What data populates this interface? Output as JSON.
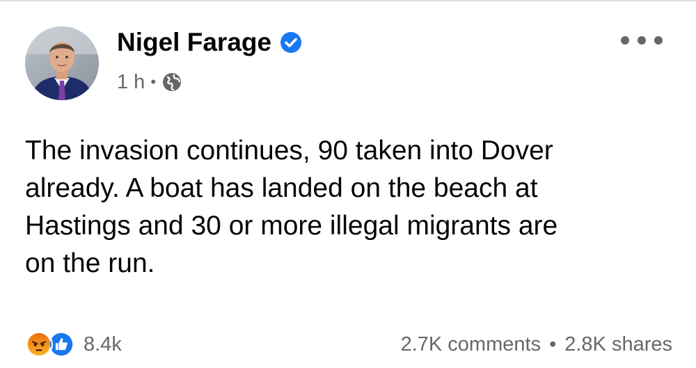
{
  "post": {
    "author": "Nigel Farage",
    "verified": true,
    "timestamp": "1 h",
    "separator": "•",
    "visibility_icon": "globe-icon",
    "text": "The invasion continues, 90 taken into Dover\nalready. A boat has landed on the beach at\nHastings and 30 or more illegal migrants are\non the run.",
    "reactions": {
      "icons": [
        "angry-reaction-icon",
        "like-reaction-icon"
      ],
      "count": "8.4k"
    },
    "comments": "2.7K comments",
    "separator_bullet": "•",
    "shares": "2.8K shares"
  },
  "colors": {
    "accent": "#1877f2",
    "text_primary": "#050505",
    "text_secondary": "#65676b",
    "angry_start": "#f7b125",
    "angry_end": "#e9710f"
  }
}
